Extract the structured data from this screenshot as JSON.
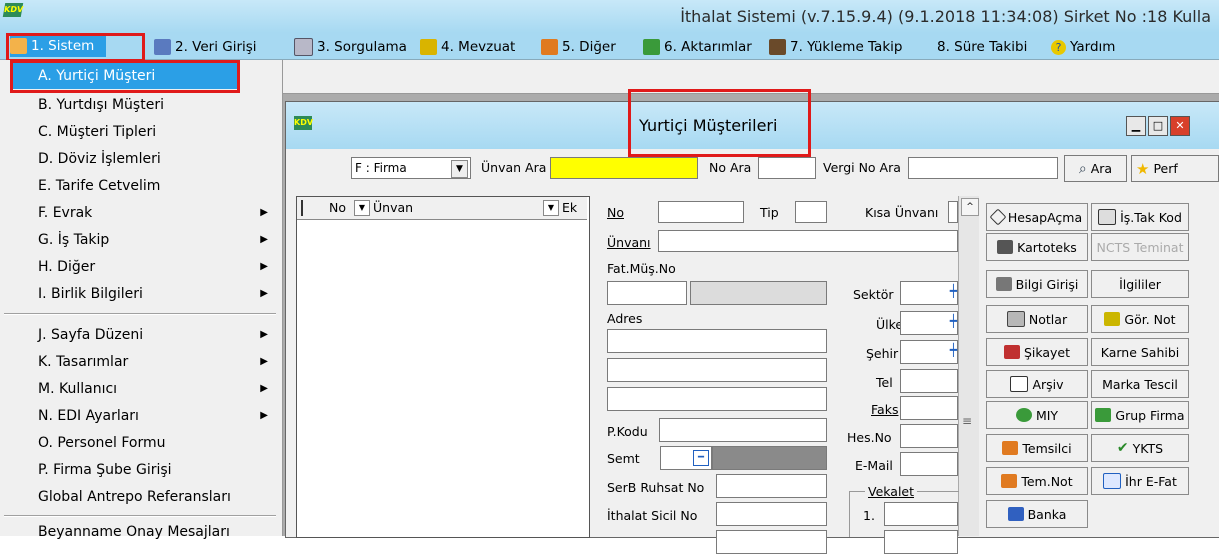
{
  "title_bar": {
    "app_icon": "app-logo-icon",
    "text": "İthalat Sistemi (v.7.15.9.4) (9.1.2018 11:34:08) Sirket No :18 Kulla"
  },
  "menubar": {
    "items": [
      {
        "label": "1. Sistem",
        "icon": "system-icon"
      },
      {
        "label": "2. Veri Girişi",
        "icon": "data-entry-icon"
      },
      {
        "label": "3. Sorgulama",
        "icon": "query-icon"
      },
      {
        "label": "4. Mevzuat",
        "icon": "books-icon"
      },
      {
        "label": "5. Diğer",
        "icon": "puzzle-icon"
      },
      {
        "label": "6. Aktarımlar",
        "icon": "transfer-icon"
      },
      {
        "label": "7. Yükleme Takip",
        "icon": "tracking-icon"
      },
      {
        "label": "8. Süre Takibi",
        "icon": ""
      },
      {
        "label": "Yardım",
        "icon": "help-icon"
      }
    ]
  },
  "dropdown": {
    "items": [
      {
        "label": "A.  Yurtiçi Müşteri",
        "submenu": false
      },
      {
        "label": "B.  Yurtdışı Müşteri",
        "submenu": false
      },
      {
        "label": "C.  Müşteri Tipleri",
        "submenu": false
      },
      {
        "label": "D.  Döviz İşlemleri",
        "submenu": false
      },
      {
        "label": "E.  Tarife Cetvelim",
        "submenu": false
      },
      {
        "label": "F.  Evrak",
        "submenu": true
      },
      {
        "label": "G.  İş Takip",
        "submenu": true
      },
      {
        "label": "H.  Diğer",
        "submenu": true
      },
      {
        "label": "I.  Birlik Bilgileri",
        "submenu": true
      },
      {
        "label": "J.  Sayfa Düzeni",
        "submenu": true
      },
      {
        "label": "K.  Tasarımlar",
        "submenu": true
      },
      {
        "label": "M.  Kullanıcı",
        "submenu": true
      },
      {
        "label": "N.  EDI Ayarları",
        "submenu": true
      },
      {
        "label": "O.  Personel Formu",
        "submenu": false
      },
      {
        "label": "P.  Firma Şube Girişi",
        "submenu": false
      },
      {
        "label": "Global Antrepo Referansları",
        "submenu": false
      },
      {
        "label": "Beyanname Onay Mesajları",
        "submenu": false
      }
    ]
  },
  "window": {
    "title": "Yurtiçi Müşterileri",
    "search": {
      "type_select": "F : Firma",
      "unvan_label": "Ünvan Ara",
      "unvan_value": "",
      "no_label": "No Ara",
      "no_value": "",
      "vergi_label": "Vergi No Ara",
      "vergi_value": "",
      "ara_button": "Ara",
      "perf_button": "Perf"
    },
    "list": {
      "col_no": "No",
      "col_unvan": "Ünvan",
      "col_ek": "Ek"
    },
    "form": {
      "no": "No",
      "tip": "Tip",
      "kisa_unvani": "Kısa Ünvanı",
      "unvani": "Ünvanı",
      "fat_mus_no": "Fat.Müş.No",
      "sektor": "Sektör",
      "adres": "Adres",
      "ulke": "Ülke",
      "sehir": "Şehir",
      "tel": "Tel",
      "faks": "Faks",
      "p_kodu": "P.Kodu",
      "hes_no": "Hes.No",
      "semt": "Semt",
      "e_mail": "E-Mail",
      "serb_ruhsat_no": "SerB Ruhsat No",
      "vekalet": "Vekalet",
      "vekalet_1": "1.",
      "ithalat_sicil_no": "İthalat Sicil No"
    },
    "buttons_left": [
      {
        "label": "HesapAçma",
        "icon": "tag-icon",
        "enabled": true
      },
      {
        "label": "Kartoteks",
        "icon": "cards-icon",
        "enabled": true
      },
      {
        "label": "Bilgi Girişi",
        "icon": "document-icon",
        "enabled": true
      },
      {
        "label": "Notlar",
        "icon": "notes-icon",
        "enabled": true
      },
      {
        "label": "Şikayet",
        "icon": "complaint-icon",
        "enabled": true
      },
      {
        "label": "Arşiv",
        "icon": "archive-search-icon",
        "enabled": true
      },
      {
        "label": "MIY",
        "icon": "globe-icon",
        "enabled": true
      },
      {
        "label": "Temsilci",
        "icon": "people-icon",
        "enabled": true
      },
      {
        "label": "Tem.Not",
        "icon": "people-icon",
        "enabled": true
      },
      {
        "label": "Banka",
        "icon": "bank-icon",
        "enabled": true
      }
    ],
    "buttons_right": [
      {
        "label": "İş.Tak Kod",
        "icon": "calendar-icon",
        "enabled": true
      },
      {
        "label": "NCTS Teminat",
        "icon": "",
        "enabled": false
      },
      {
        "label": "İlgililer",
        "icon": "",
        "enabled": true
      },
      {
        "label": "Gör. Not",
        "icon": "note-icon",
        "enabled": true
      },
      {
        "label": "Karne Sahibi",
        "icon": "",
        "enabled": true
      },
      {
        "label": "Marka Tescil",
        "icon": "",
        "enabled": true
      },
      {
        "label": "Grup Firma",
        "icon": "group-icon",
        "enabled": true
      },
      {
        "label": "YKTS",
        "icon": "check-icon",
        "enabled": true
      },
      {
        "label": "İhr E-Fat",
        "icon": "invoice-icon",
        "enabled": true
      }
    ]
  }
}
